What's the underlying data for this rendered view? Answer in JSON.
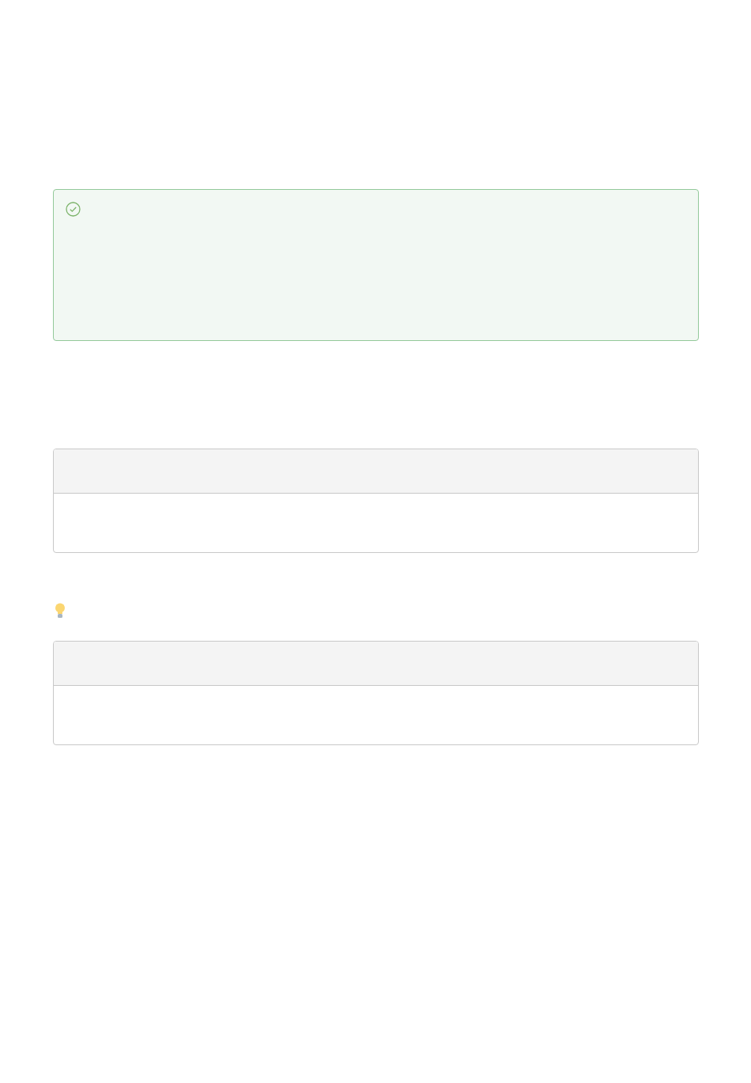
{
  "blocks": [
    {
      "kind": "success-panel"
    },
    {
      "kind": "code-block"
    },
    {
      "kind": "tip"
    },
    {
      "kind": "code-block"
    }
  ]
}
